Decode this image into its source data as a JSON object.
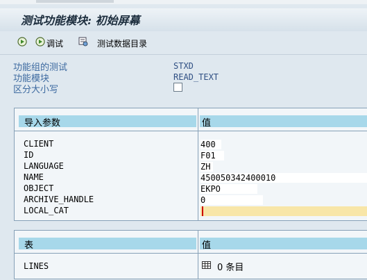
{
  "window": {
    "title": "测试功能模块: 初始屏幕"
  },
  "toolbar": {
    "debug_label": "调试",
    "data_dir_label": "测试数据目录"
  },
  "fields": [
    {
      "label": "功能组的测试",
      "value": "STXD"
    },
    {
      "label": "功能模块",
      "value": "READ_TEXT"
    },
    {
      "label": "区分大小写",
      "value": ""
    }
  ],
  "import_table": {
    "col_param": "导入参数",
    "col_value": "值",
    "rows": [
      {
        "name": "CLIENT",
        "value": "400"
      },
      {
        "name": "ID",
        "value": "F01"
      },
      {
        "name": "LANGUAGE",
        "value": "ZH"
      },
      {
        "name": "NAME",
        "value": "450050342400010"
      },
      {
        "name": "OBJECT",
        "value": "EKPO"
      },
      {
        "name": "ARCHIVE_HANDLE",
        "value": "0"
      },
      {
        "name": "LOCAL_CAT",
        "value": ""
      }
    ]
  },
  "tables_table": {
    "col_param": "表",
    "col_value": "值",
    "rows": [
      {
        "name": "LINES",
        "value": "0 条目"
      }
    ]
  }
}
